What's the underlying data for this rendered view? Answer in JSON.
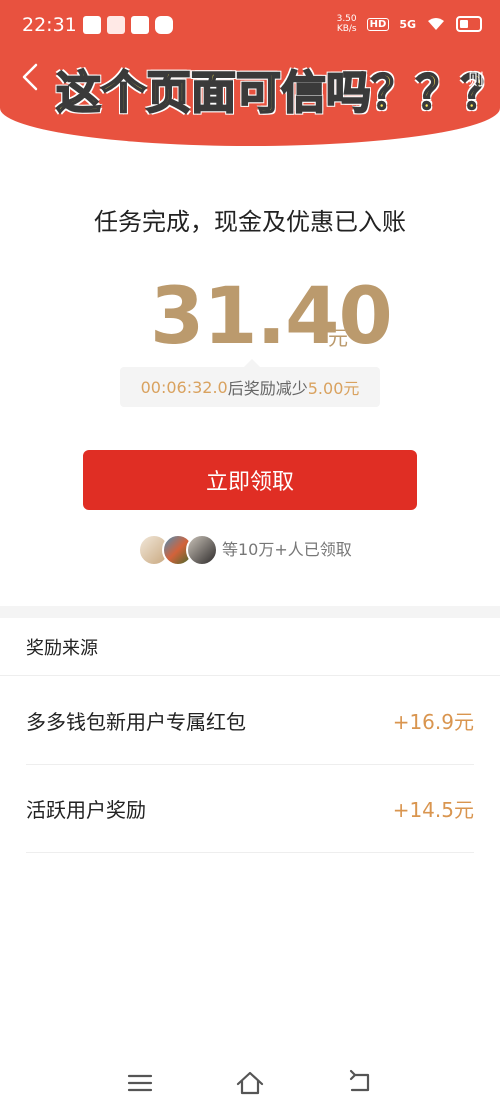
{
  "status_bar": {
    "time": "22:31",
    "speed_value": "3.50",
    "speed_unit": "KB/s",
    "hd": "HD",
    "network": "5G"
  },
  "header": {
    "banner_title": "这个页面可信吗？？？",
    "rules_fragment": "则",
    "background_color": "#e8523f"
  },
  "main": {
    "headline": "任务完成，现金及优惠已入账",
    "amount": "31.40",
    "amount_unit": "元",
    "countdown_time": "00:06:32.0",
    "countdown_text": "后奖励减少",
    "countdown_amount": "5.00元",
    "claim_button": "立即领取",
    "social_proof": "等10万+人已领取"
  },
  "sources": {
    "title": "奖励来源",
    "items": [
      {
        "name": "多多钱包新用户专属红包",
        "amount": "+16.9元"
      },
      {
        "name": "活跃用户奖励",
        "amount": "+14.5元"
      }
    ]
  },
  "colors": {
    "accent_red": "#e02e24",
    "gold": "#bb9a6d",
    "orange": "#d9954f"
  },
  "icons": [
    "back-icon",
    "menu-icon",
    "home-icon",
    "return-icon"
  ]
}
